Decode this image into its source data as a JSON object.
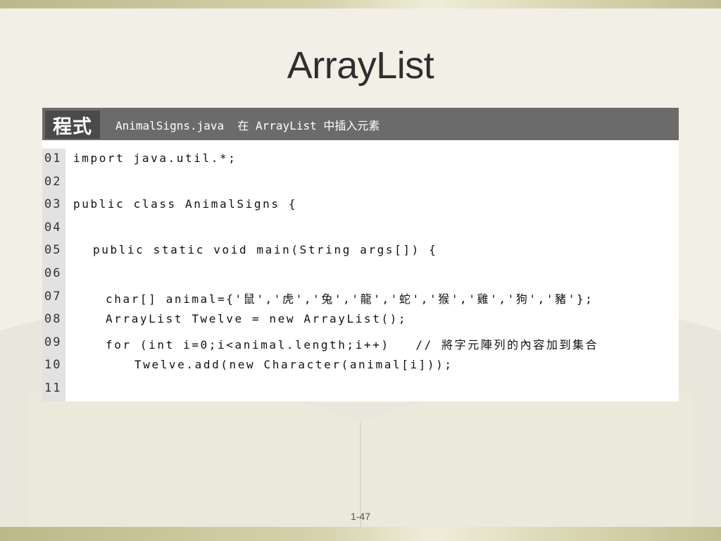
{
  "slide": {
    "title": "ArrayList",
    "page_number": "1-47"
  },
  "code_box": {
    "tag": "程式",
    "caption": "AnimalSigns.java  在 ArrayList 中插入元素"
  },
  "code_lines": [
    {
      "num": "01",
      "code": "import java.util.*;",
      "indent": 0
    },
    {
      "num": "02",
      "code": "",
      "indent": 0
    },
    {
      "num": "03",
      "code": "public class AnimalSigns {",
      "indent": 0
    },
    {
      "num": "04",
      "code": "",
      "indent": 0
    },
    {
      "num": "05",
      "code": "public static void main(String args[]) {",
      "indent": 1
    },
    {
      "num": "06",
      "code": "",
      "indent": 0
    },
    {
      "num": "07",
      "code": "char[] animal={'鼠','虎','兔','龍','蛇','猴','雞','狗','豬'};",
      "indent": 2
    },
    {
      "num": "08",
      "code": "ArrayList Twelve = new ArrayList();",
      "indent": 2
    },
    {
      "num": "09",
      "code": "for (int i=0;i<animal.length;i++)   // 將字元陣列的內容加到集合",
      "indent": 2
    },
    {
      "num": "10",
      "code": "Twelve.add(new Character(animal[i]));",
      "indent": 3
    },
    {
      "num": "11",
      "code": "",
      "indent": 0
    }
  ]
}
